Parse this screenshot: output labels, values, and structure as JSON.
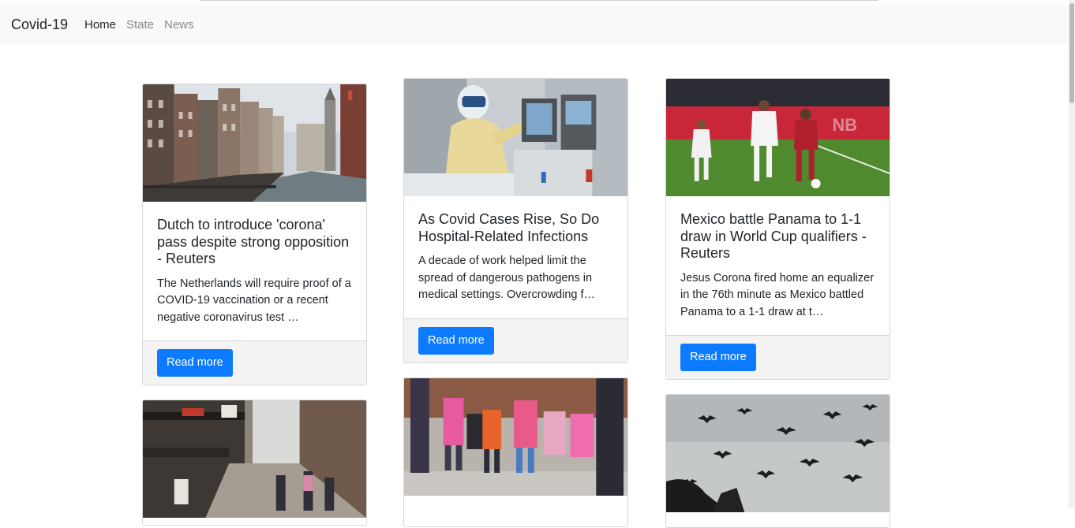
{
  "navbar": {
    "brand": "Covid-19",
    "links": [
      {
        "label": "Home",
        "active": true
      },
      {
        "label": "State",
        "active": false
      },
      {
        "label": "News",
        "active": false
      }
    ]
  },
  "articles": [
    {
      "image": "Amsterdam canal with historic houses",
      "title": "Dutch to introduce 'corona' pass despite strong opposition - Reuters",
      "description": "The Netherlands will require proof of a COVID-19 vaccination or a recent negative coronavirus test …",
      "button": "Read more"
    },
    {
      "image": "Healthcare worker in protective gear adjusting hospital equipment",
      "title": "As Covid Cases Rise, So Do Hospital-Related Infections",
      "description": "A decade of work helped limit the spread of dangerous pathogens in medical settings. Overcrowding f…",
      "button": "Read more"
    },
    {
      "image": "Football players in Mexico vs Panama match",
      "title": "Mexico battle Panama to 1-1 draw in World Cup qualifiers - Reuters",
      "description": "Jesus Corona fired home an equalizer in the 76th minute as Mexico battled Panama to a 1-1 draw at t…",
      "button": "Read more"
    },
    {
      "image": "Busy shopping street with pedestrians"
    },
    {
      "image": "Group of children in face masks outside"
    },
    {
      "image": "Flock of bats flying against grey sky"
    }
  ]
}
